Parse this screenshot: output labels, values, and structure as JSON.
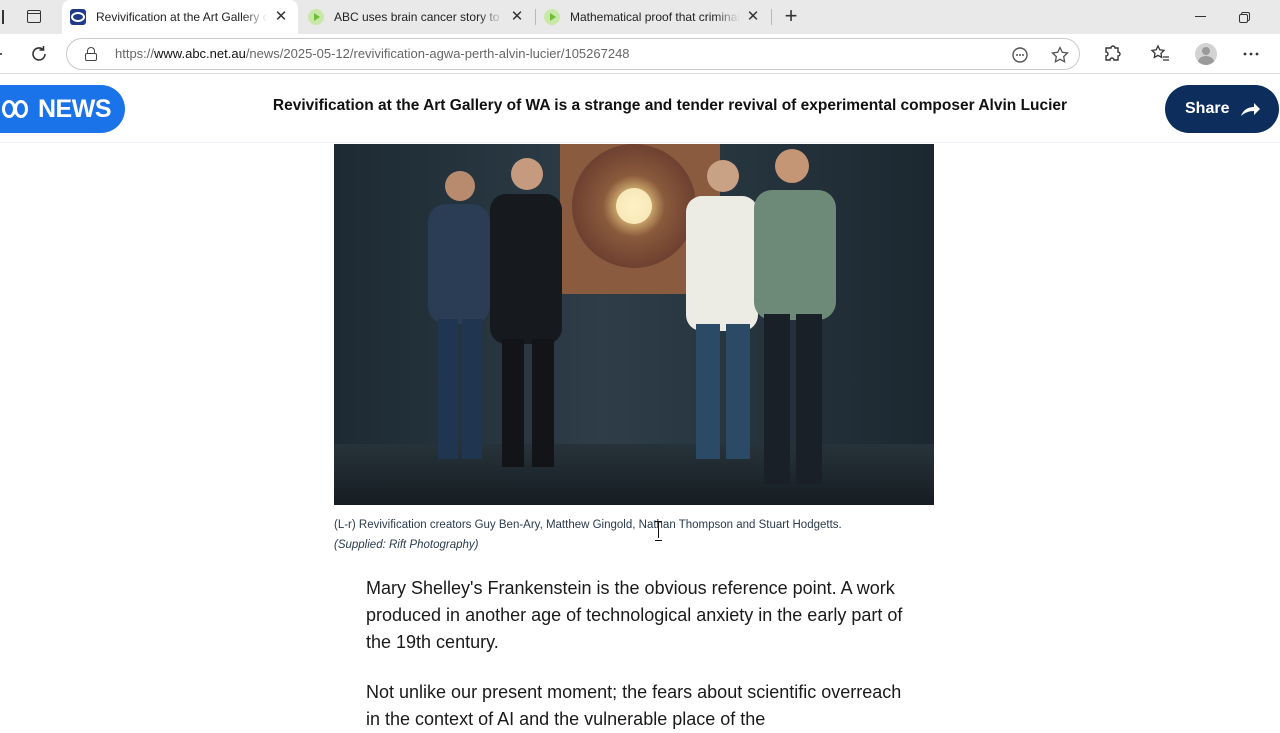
{
  "browser": {
    "tabs": [
      {
        "title": "Revivification at the Art Gallery of WA is a strange and tender revival",
        "favicon": "abc-news-icon",
        "active": true
      },
      {
        "title": "ABC uses brain cancer story to campaign",
        "favicon": "play-icon",
        "active": false
      },
      {
        "title": "Mathematical proof that criminality",
        "favicon": "play-icon",
        "active": false
      }
    ],
    "url_prefix": "https://",
    "url_host": "www.abc.net.au",
    "url_path": "/news/2025-05-12/revivification-agwa-perth-alvin-lucier/105267248",
    "close_glyph": "✕",
    "new_tab_glyph": "+"
  },
  "site": {
    "logo_text": "NEWS",
    "headline": "Revivification at the Art Gallery of WA is a strange and tender revival of experimental composer Alvin Lucier",
    "share_label": "Share",
    "brand_color": "#1a73e8",
    "share_color": "#0d2e5c"
  },
  "article": {
    "caption": "(L-r) Revivification creators Guy Ben-Ary, Matthew Gingold, Nathan Thompson and Stuart Hodgetts.",
    "credit": "(Supplied: Rift Photography)",
    "paragraphs": [
      "Mary Shelley's Frankenstein is the obvious reference point. A work produced in another age of technological anxiety in the early part of the 19th century.",
      "Not unlike our present moment; the fears about scientific overreach in the context of AI and the vulnerable place of the"
    ]
  }
}
